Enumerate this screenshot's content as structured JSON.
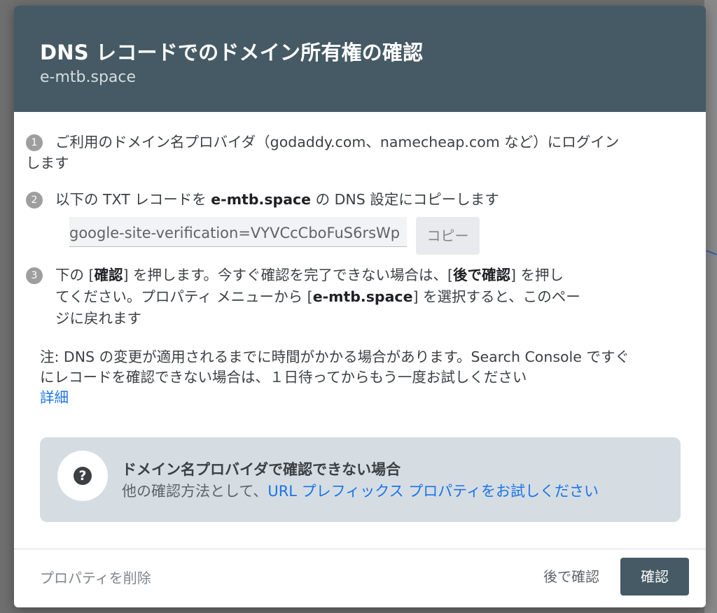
{
  "dialog": {
    "title": "DNS レコードでのドメイン所有権の確認",
    "domain": "e-mtb.space"
  },
  "steps": [
    {
      "number": "1",
      "line1": "ご利用のドメイン名プロバイダ（godaddy.com、namecheap.com など）にログイン",
      "line2": "します"
    },
    {
      "number": "2",
      "pre": "以下の TXT レコードを ",
      "domain": "e-mtb.space",
      "post": " の DNS 設定にコピーします"
    },
    {
      "number": "3",
      "l1_pre": "下の [",
      "l1_b1": "確認",
      "l1_mid": "] を押します。今すぐ確認を完了できない場合は、[",
      "l1_b2": "後で確認",
      "l1_post": "] を押し",
      "l2_pre": "てください。プロパティ メニューから [",
      "l2_b": "e-mtb.space",
      "l2_post": "] を選択すると、このペー",
      "l3": "ジに戻れます"
    }
  ],
  "txt_record": {
    "value": "google-site-verification=VYVCcCboFuS6rsWp",
    "copy_label": "コピー"
  },
  "note": {
    "line1": "注: DNS の変更が適用されるまでに時間がかかる場合があります。Search Console ですぐ",
    "line2": "にレコードを確認できない場合は、１日待ってからもう一度お試しください",
    "link": "詳細"
  },
  "info_box": {
    "icon": "question-icon",
    "title": "ドメイン名プロバイダで確認できない場合",
    "text_pre": "他の確認方法として、",
    "link": "URL プレフィックス プロパティをお試しください"
  },
  "footer": {
    "delete_label": "プロパティを削除",
    "later_label": "後で確認",
    "confirm_label": "確認"
  },
  "colors": {
    "header": "#455a64",
    "link": "#1a73e8",
    "info_bg": "#d5dde3"
  }
}
